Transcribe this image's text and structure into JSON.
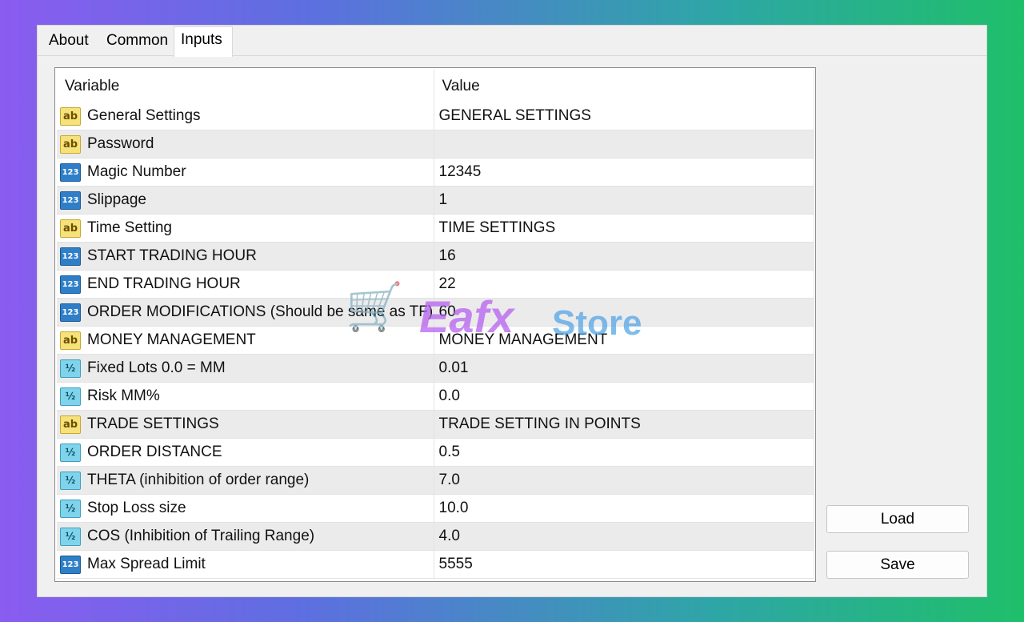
{
  "tabs": [
    "About",
    "Common",
    "Inputs"
  ],
  "active_tab": "Inputs",
  "table": {
    "headers": [
      "Variable",
      "Value"
    ],
    "rows": [
      {
        "type": "ab",
        "variable": "General Settings",
        "value": "GENERAL SETTINGS"
      },
      {
        "type": "ab",
        "variable": "Password",
        "value": ""
      },
      {
        "type": "123",
        "variable": "Magic Number",
        "value": "12345"
      },
      {
        "type": "123",
        "variable": "Slippage",
        "value": "1"
      },
      {
        "type": "ab",
        "variable": "Time Setting",
        "value": "TIME SETTINGS"
      },
      {
        "type": "123",
        "variable": "START TRADING HOUR",
        "value": "16"
      },
      {
        "type": "123",
        "variable": "END TRADING HOUR",
        "value": "22"
      },
      {
        "type": "123",
        "variable": "ORDER MODIFICATIONS (Should be same as TF)",
        "value": "60"
      },
      {
        "type": "ab",
        "variable": "MONEY MANAGEMENT",
        "value": "MONEY MANAGEMENT"
      },
      {
        "type": "half",
        "variable": "Fixed Lots 0.0 = MM",
        "value": "0.01"
      },
      {
        "type": "half",
        "variable": "Risk MM%",
        "value": "0.0"
      },
      {
        "type": "ab",
        "variable": "TRADE SETTINGS",
        "value": "TRADE SETTING IN POINTS"
      },
      {
        "type": "half",
        "variable": "ORDER DISTANCE",
        "value": "0.5"
      },
      {
        "type": "half",
        "variable": "THETA (inhibition of order range)",
        "value": "7.0"
      },
      {
        "type": "half",
        "variable": "Stop Loss size",
        "value": "10.0"
      },
      {
        "type": "half",
        "variable": "COS (Inhibition of Trailing Range)",
        "value": "4.0"
      },
      {
        "type": "123",
        "variable": "Max Spread Limit",
        "value": "5555"
      }
    ]
  },
  "icons": {
    "ab": "ab",
    "123": "123",
    "half": "½"
  },
  "icon_names": {
    "ab": "string-type-icon",
    "123": "integer-type-icon",
    "half": "double-type-icon"
  },
  "buttons": {
    "load": "Load",
    "save": "Save"
  },
  "watermark": {
    "brand": "Eafx",
    "suffix": "Store"
  }
}
